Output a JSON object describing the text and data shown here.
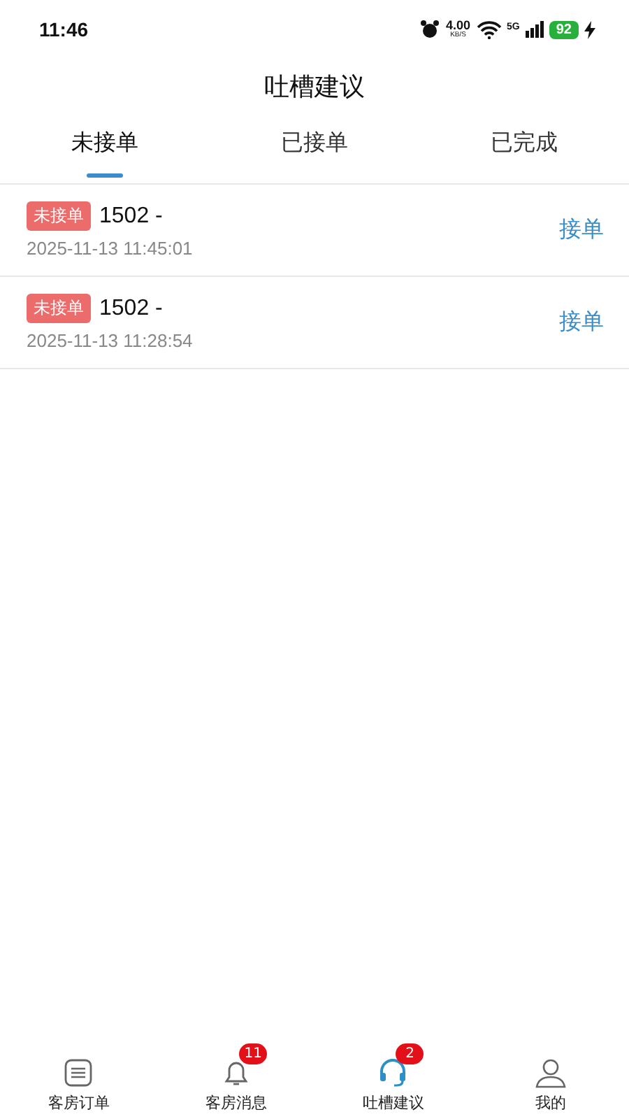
{
  "status_bar": {
    "time": "11:46",
    "net_speed": "4.00",
    "net_unit": "KB/S",
    "network": "5G",
    "battery": "92"
  },
  "title": "吐槽建议",
  "tabs": [
    {
      "label": "未接单",
      "selected": true
    },
    {
      "label": "已接单",
      "selected": false
    },
    {
      "label": "已完成",
      "selected": false
    }
  ],
  "orders": [
    {
      "status": "未接单",
      "room": "1502 -",
      "time": "2025-11-13 11:45:01",
      "action": "接单"
    },
    {
      "status": "未接单",
      "room": "1502 -",
      "time": "2025-11-13 11:28:54",
      "action": "接单"
    }
  ],
  "bottom_nav": [
    {
      "kind": "list",
      "label": "客房订单",
      "selected": false
    },
    {
      "kind": "bell",
      "label": "客房消息",
      "selected": false,
      "badge": "11"
    },
    {
      "kind": "headset",
      "label": "吐槽建议",
      "selected": true,
      "badge": "2"
    },
    {
      "kind": "person",
      "label": "我的",
      "selected": false
    }
  ]
}
